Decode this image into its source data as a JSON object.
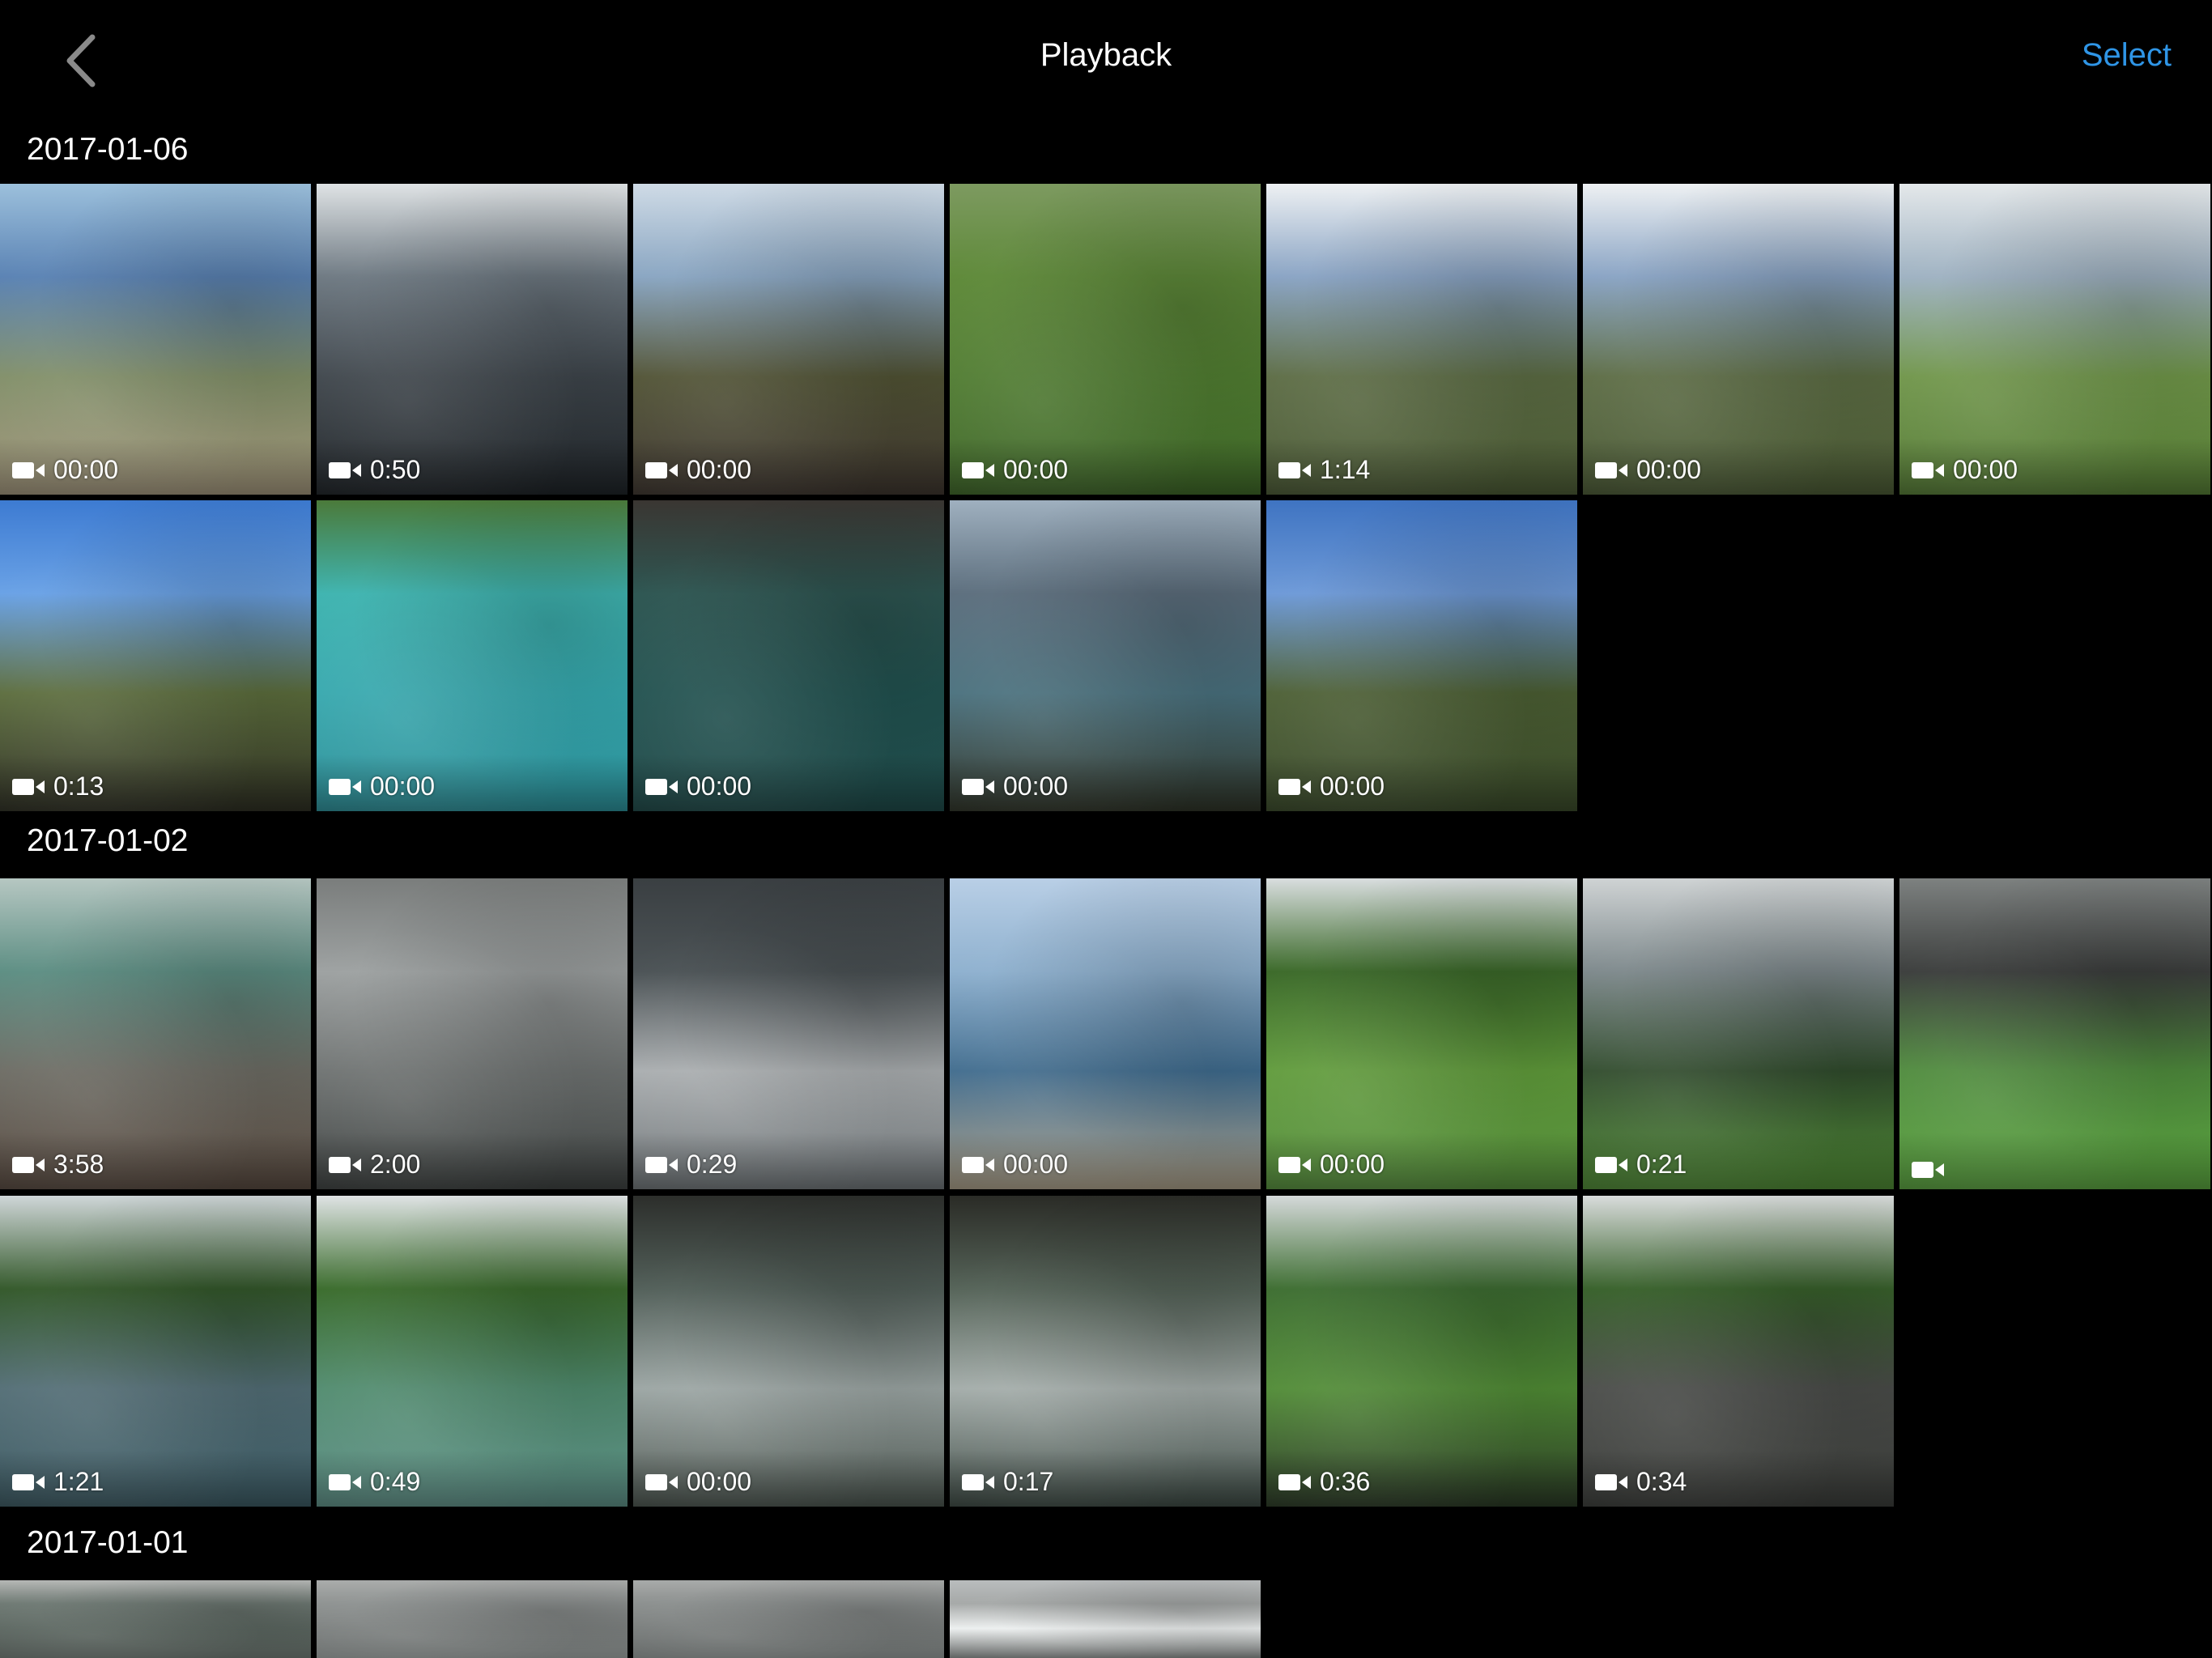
{
  "header": {
    "title": "Playback",
    "select_label": "Select"
  },
  "colors": {
    "accent": "#2f95e6",
    "background": "#000000"
  },
  "sections": [
    {
      "date": "2017-01-06",
      "items": [
        {
          "duration": "00:00",
          "scene": [
            "#9cc0dc",
            "#5b83b4",
            "#7f8d66",
            "#a0947a"
          ]
        },
        {
          "duration": "0:50",
          "scene": [
            "#dfe3e5",
            "#6f7a83",
            "#3d444a",
            "#1f2428"
          ]
        },
        {
          "duration": "00:00",
          "scene": [
            "#cfdbe6",
            "#8aa6c2",
            "#4f5133",
            "#3e362f"
          ]
        },
        {
          "duration": "00:00",
          "scene": [
            "#7d9a60",
            "#5f8a3a",
            "#4f7b30",
            "#3e6628"
          ]
        },
        {
          "duration": "1:14",
          "scene": [
            "#eef1f3",
            "#8aa4c4",
            "#5a6a42",
            "#4b5a35"
          ]
        },
        {
          "duration": "00:00",
          "scene": [
            "#eef1f3",
            "#8aa4c4",
            "#5a6a42",
            "#4b5a35"
          ]
        },
        {
          "duration": "00:00",
          "scene": [
            "#e4e8ea",
            "#9fb2c2",
            "#6e9448",
            "#557b35"
          ]
        },
        {
          "duration": "0:13",
          "scene": [
            "#3d7bd2",
            "#6aa2e6",
            "#5a6b3b",
            "#2f3024"
          ]
        },
        {
          "duration": "00:00",
          "scene": [
            "#4b7a3a",
            "#3fb4b0",
            "#35a7ad",
            "#2c8f98"
          ]
        },
        {
          "duration": "00:00",
          "scene": [
            "#3a3632",
            "#2e5652",
            "#20504e",
            "#1f4a49"
          ]
        },
        {
          "duration": "00:00",
          "scene": [
            "#9fb0bf",
            "#5d6f7e",
            "#486f7c",
            "#2f3428"
          ]
        },
        {
          "duration": "00:00",
          "scene": [
            "#3f74c2",
            "#6e9ad8",
            "#4a5d32",
            "#3a4a2a"
          ]
        }
      ]
    },
    {
      "date": "2017-01-02",
      "items": [
        {
          "duration": "3:58",
          "scene": [
            "#b6c7c2",
            "#5e8f84",
            "#6b6a62",
            "#584a40"
          ]
        },
        {
          "duration": "2:00",
          "scene": [
            "#7a7d7c",
            "#9ea2a2",
            "#6d7170",
            "#3e4241"
          ]
        },
        {
          "duration": "0:29",
          "scene": [
            "#3a3f42",
            "#4c5356",
            "#a8acae",
            "#6e7477"
          ]
        },
        {
          "duration": "00:00",
          "scene": [
            "#b9cfe6",
            "#8fb1cf",
            "#3e6a8c",
            "#a99d86"
          ]
        },
        {
          "duration": "00:00",
          "scene": [
            "#d9dedf",
            "#3c6a2a",
            "#5f9a3a",
            "#568f3c"
          ]
        },
        {
          "duration": "0:21",
          "scene": [
            "#cfd3d4",
            "#7f8a8d",
            "#2f4a2b",
            "#4f8a35"
          ]
        },
        {
          "duration": "",
          "scene": [
            "#7d8180",
            "#3d3f3e",
            "#4e8a3c",
            "#5aa33f"
          ]
        }
      ]
    },
    {
      "date": "",
      "items": [
        {
          "duration": "1:21",
          "scene": [
            "#cfd6d8",
            "#355a2c",
            "#516c74",
            "#3c5a63"
          ]
        },
        {
          "duration": "0:49",
          "scene": [
            "#dfe3e4",
            "#3c6d2e",
            "#4f8a6d",
            "#5d8f86"
          ]
        },
        {
          "duration": "00:00",
          "scene": [
            "#2c2e2b",
            "#53605a",
            "#9aa4a2",
            "#4b554f"
          ]
        },
        {
          "duration": "0:17",
          "scene": [
            "#2a2b26",
            "#566459",
            "#a2aba8",
            "#3d4a44"
          ]
        },
        {
          "duration": "0:36",
          "scene": [
            "#d5d9da",
            "#3f6f33",
            "#4f8a34",
            "#2b3a26"
          ]
        },
        {
          "duration": "0:34",
          "scene": [
            "#d9dcdc",
            "#39622c",
            "#484a47",
            "#3b3d3a"
          ]
        }
      ]
    },
    {
      "date": "2017-01-01",
      "items": [
        {
          "duration": "",
          "scene": [
            "#b5b7b5",
            "#6f7a74",
            "#5a655f",
            "#4b524e"
          ]
        },
        {
          "duration": "",
          "scene": [
            "#aaacab",
            "#8f9392",
            "#7b7f7e",
            "#6a6e6d"
          ]
        },
        {
          "duration": "",
          "scene": [
            "#a8aaa9",
            "#8c908f",
            "#777b7a",
            "#626665"
          ]
        },
        {
          "duration": "",
          "scene": [
            "#b9bcbd",
            "#a6a9a8",
            "#ecefef",
            "#5c5f5e"
          ]
        }
      ]
    }
  ]
}
